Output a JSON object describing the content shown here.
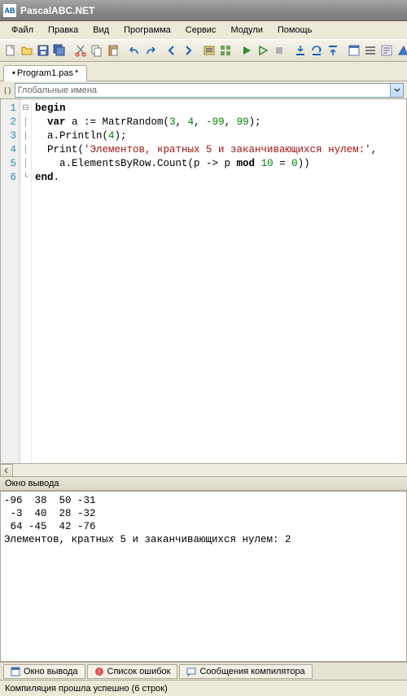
{
  "title": "PascalABC.NET",
  "menu": {
    "file": "Файл",
    "edit": "Правка",
    "view": "Вид",
    "program": "Программа",
    "service": "Сервис",
    "modules": "Модули",
    "help": "Помощь"
  },
  "tab": {
    "name": "Program1.pas",
    "dirty": "•",
    "asterisk": "*"
  },
  "names_dropdown": "Глобальные имена",
  "code": {
    "l1": {
      "kw": "begin"
    },
    "l2": {
      "kw": "var",
      "t1": " a := MatrRandom(",
      "n1": "3",
      "c": ", ",
      "n2": "4",
      "n3": "-99",
      "n4": "99",
      "t2": ");"
    },
    "l3": {
      "t1": "  a.Println(",
      "n1": "4",
      "t2": ");"
    },
    "l4": {
      "t1": "  Print(",
      "s": "'Элементов, кратных 5 и заканчивающихся нулем:'",
      "t2": ","
    },
    "l5": {
      "t1": "    a.ElementsByRow.Count(p -> p ",
      "kw": "mod",
      "t2": " ",
      "n1": "10",
      "t3": " = ",
      "n2": "0",
      "t4": "))"
    },
    "l6": {
      "kw": "end",
      "t1": "."
    },
    "gutter": [
      "1",
      "2",
      "3",
      "4",
      "5",
      "6"
    ]
  },
  "output_panel_title": "Окно вывода",
  "output_lines": [
    "-96  38  50 -31",
    " -3  40  28 -32",
    " 64 -45  42 -76",
    "Элементов, кратных 5 и заканчивающихся нулем: 2"
  ],
  "bottom_tabs": {
    "output": "Окно вывода",
    "errors": "Список ошибок",
    "compiler": "Сообщения компилятора"
  },
  "status": "Компиляция прошла успешно (6 строк)"
}
